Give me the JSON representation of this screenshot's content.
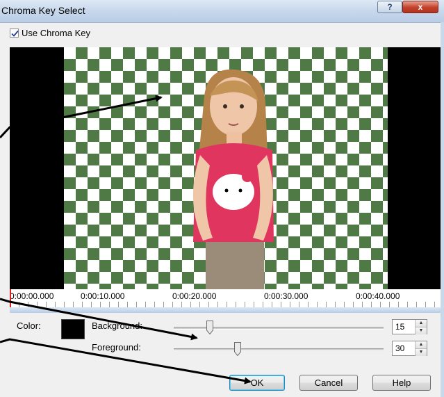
{
  "window": {
    "title": "Chroma Key Select",
    "help_glyph": "?",
    "close_glyph": "x"
  },
  "options": {
    "use_chroma_key_label": "Use Chroma Key",
    "use_chroma_key_checked": true
  },
  "timeline": {
    "ticks": [
      "0:00:00.000",
      "0:00:10.000",
      "0:00:20.000",
      "0:00:30.000",
      "0:00:40.000"
    ]
  },
  "color": {
    "label": "Color:",
    "value": "#000000"
  },
  "background": {
    "label": "Background:",
    "value": "15"
  },
  "foreground": {
    "label": "Foreground:",
    "value": "30"
  },
  "buttons": {
    "ok": "OK",
    "cancel": "Cancel",
    "help": "Help"
  },
  "colors": {
    "checker_green": "#4f7a45",
    "preview_bg": "#000000",
    "ok_focus": "#3c7fb1"
  },
  "icons": {
    "checkmark": "checkmark-icon",
    "spin_up": "spin-up-icon",
    "spin_down": "spin-down-icon"
  }
}
